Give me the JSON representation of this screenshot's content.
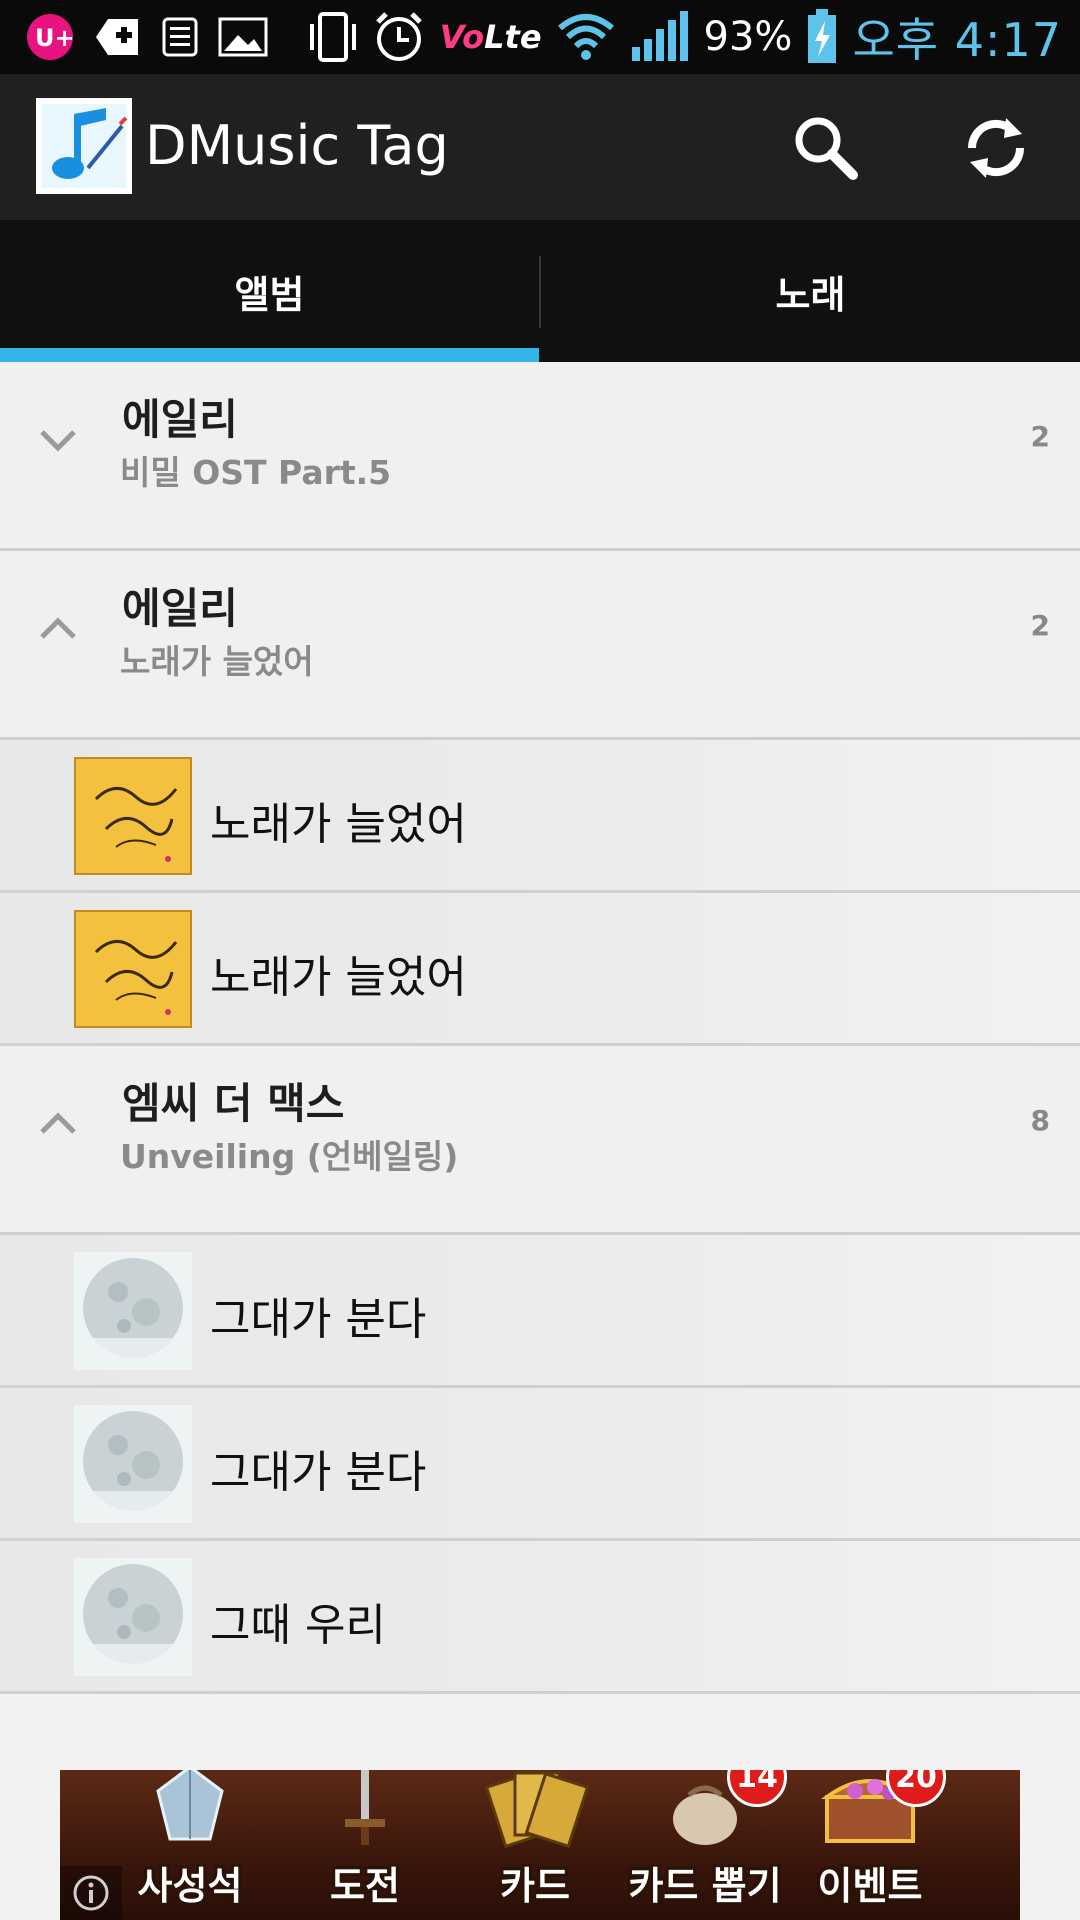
{
  "status_bar": {
    "carrier_icon": "lg-uplus-icon",
    "notifications": [
      "medical-plus-icon",
      "note-icon",
      "gallery-icon"
    ],
    "volte_label_v": "Vo",
    "volte_label_lte": "Lte",
    "battery": "93%",
    "time": "오후 4:17"
  },
  "action_bar": {
    "title": "DMusic Tag",
    "search_icon": "search-icon",
    "refresh_icon": "refresh-icon"
  },
  "tabs": [
    {
      "label": "앨범",
      "selected": true
    },
    {
      "label": "노래",
      "selected": false
    }
  ],
  "groups": [
    {
      "artist": "에일리",
      "album": "비밀 OST Part.5",
      "count": "2",
      "expanded": false,
      "songs": []
    },
    {
      "artist": "에일리",
      "album": "노래가 늘었어",
      "count": "2",
      "expanded": true,
      "songs": [
        {
          "title": "노래가 늘었어",
          "art": "gold-album-art"
        },
        {
          "title": "노래가 늘었어",
          "art": "gold-album-art"
        }
      ]
    },
    {
      "artist": "엠씨 더 맥스",
      "album": "Unveiling (언베일링)",
      "count": "8",
      "expanded": true,
      "songs": [
        {
          "title": "그대가 분다",
          "art": "moon-album-art"
        },
        {
          "title": "그대가 분다",
          "art": "moon-album-art"
        },
        {
          "title": "그때 우리",
          "art": "moon-album-art"
        }
      ]
    }
  ],
  "ad_banner": {
    "items": [
      {
        "label": "사성석",
        "badge": ""
      },
      {
        "label": "도전",
        "badge": ""
      },
      {
        "label": "카드",
        "badge": ""
      },
      {
        "label": "카드 뽑기",
        "badge": "14"
      },
      {
        "label": "이벤트",
        "badge": "20"
      }
    ],
    "info_icon": "info-icon"
  },
  "colors": {
    "accent": "#33b5e5",
    "time": "#5ec3ea",
    "badge": "#e01b1b"
  }
}
